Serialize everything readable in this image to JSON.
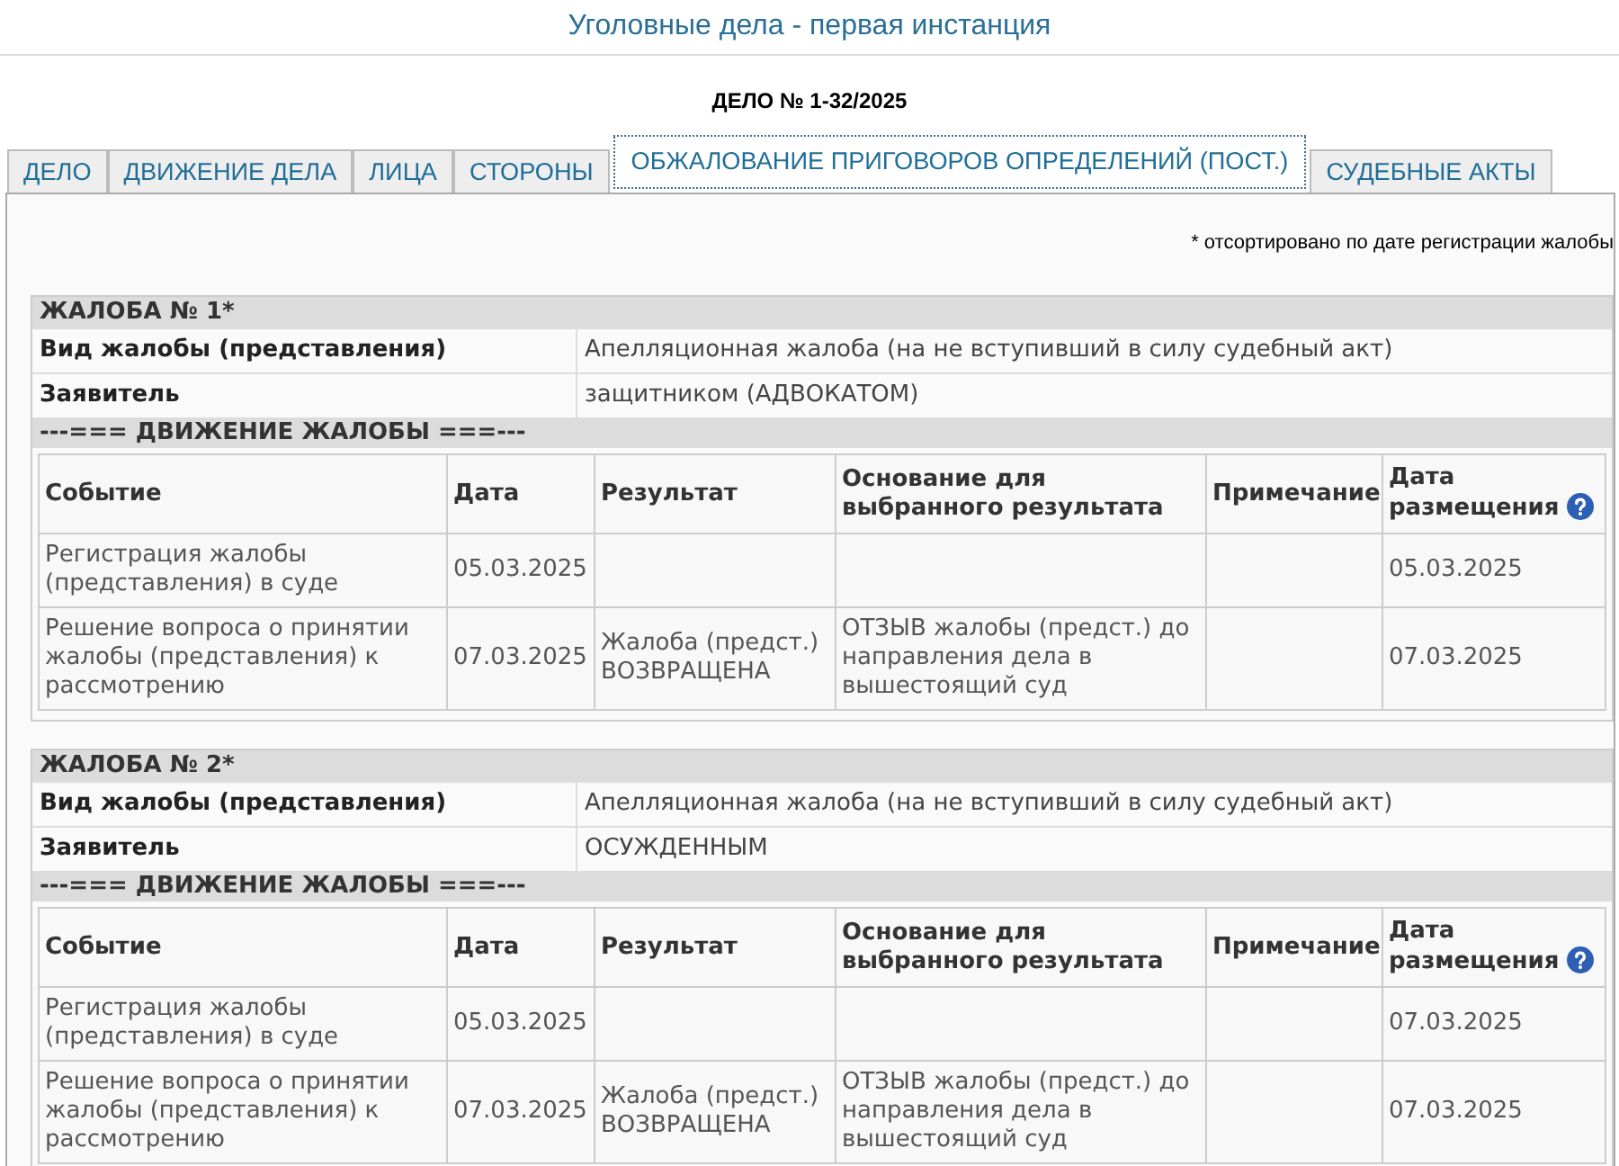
{
  "page": {
    "title": "Уголовные дела - первая инстанция",
    "case_number": "ДЕЛО № 1-32/2025"
  },
  "tabs": [
    {
      "label": "ДЕЛО",
      "selected": false
    },
    {
      "label": "ДВИЖЕНИЕ ДЕЛА",
      "selected": false
    },
    {
      "label": "ЛИЦА",
      "selected": false
    },
    {
      "label": "СТОРОНЫ",
      "selected": false
    },
    {
      "label": "ОБЖАЛОВАНИЕ ПРИГОВОРОВ ОПРЕДЕЛЕНИЙ (ПОСТ.)",
      "selected": true
    },
    {
      "label": "СУДЕБНЫЕ АКТЫ",
      "selected": false
    }
  ],
  "sort_note": "* отсортировано по дате регистрации жалобы",
  "complaints": [
    {
      "title": "ЖАЛОБА № 1*",
      "fields": [
        {
          "label": "Вид жалобы (представления)",
          "value": "Апелляционная жалоба (на не вступивший в силу судебный акт)"
        },
        {
          "label": "Заявитель",
          "value": "защитником (АДВОКАТОМ)"
        }
      ],
      "movement": {
        "title": "---=== ДВИЖЕНИЕ ЖАЛОБЫ ===---",
        "columns": [
          {
            "label": "Событие",
            "help": false
          },
          {
            "label": "Дата",
            "help": false
          },
          {
            "label": "Результат",
            "help": false
          },
          {
            "label": "Основание для выбранного результата",
            "help": false
          },
          {
            "label": "Примечание",
            "help": false
          },
          {
            "label": "Дата размещения",
            "help": true
          }
        ],
        "rows": [
          {
            "event": "Регистрация жалобы (представления) в суде",
            "date": "05.03.2025",
            "posted": "05.03.2025"
          },
          {
            "event": "Решение вопроса о принятии жалобы (представления) к рассмотрению",
            "date": "07.03.2025",
            "result": "Жалоба (предст.) ВОЗВРАЩЕНА",
            "basis": "ОТЗЫВ жалобы (предст.) до направления дела в вышестоящий суд",
            "posted": "07.03.2025"
          }
        ]
      }
    },
    {
      "title": "ЖАЛОБА № 2*",
      "fields": [
        {
          "label": "Вид жалобы (представления)",
          "value": "Апелляционная жалоба (на не вступивший в силу судебный акт)"
        },
        {
          "label": "Заявитель",
          "value": "ОСУЖДЕННЫМ"
        }
      ],
      "movement": {
        "title": "---=== ДВИЖЕНИЕ ЖАЛОБЫ ===---",
        "columns": [
          {
            "label": "Событие",
            "help": false
          },
          {
            "label": "Дата",
            "help": false
          },
          {
            "label": "Результат",
            "help": false
          },
          {
            "label": "Основание для выбранного результата",
            "help": false
          },
          {
            "label": "Примечание",
            "help": false
          },
          {
            "label": "Дата размещения",
            "help": true
          }
        ],
        "rows": [
          {
            "event": "Регистрация жалобы (представления) в суде",
            "date": "05.03.2025",
            "posted": "07.03.2025"
          },
          {
            "event": "Решение вопроса о принятии жалобы (представления) к рассмотрению",
            "date": "07.03.2025",
            "result": "Жалоба (предст.) ВОЗВРАЩЕНА",
            "basis": "ОТЗЫВ жалобы (предст.) до направления дела в вышестоящий суд",
            "posted": "07.03.2025"
          }
        ]
      }
    }
  ]
}
